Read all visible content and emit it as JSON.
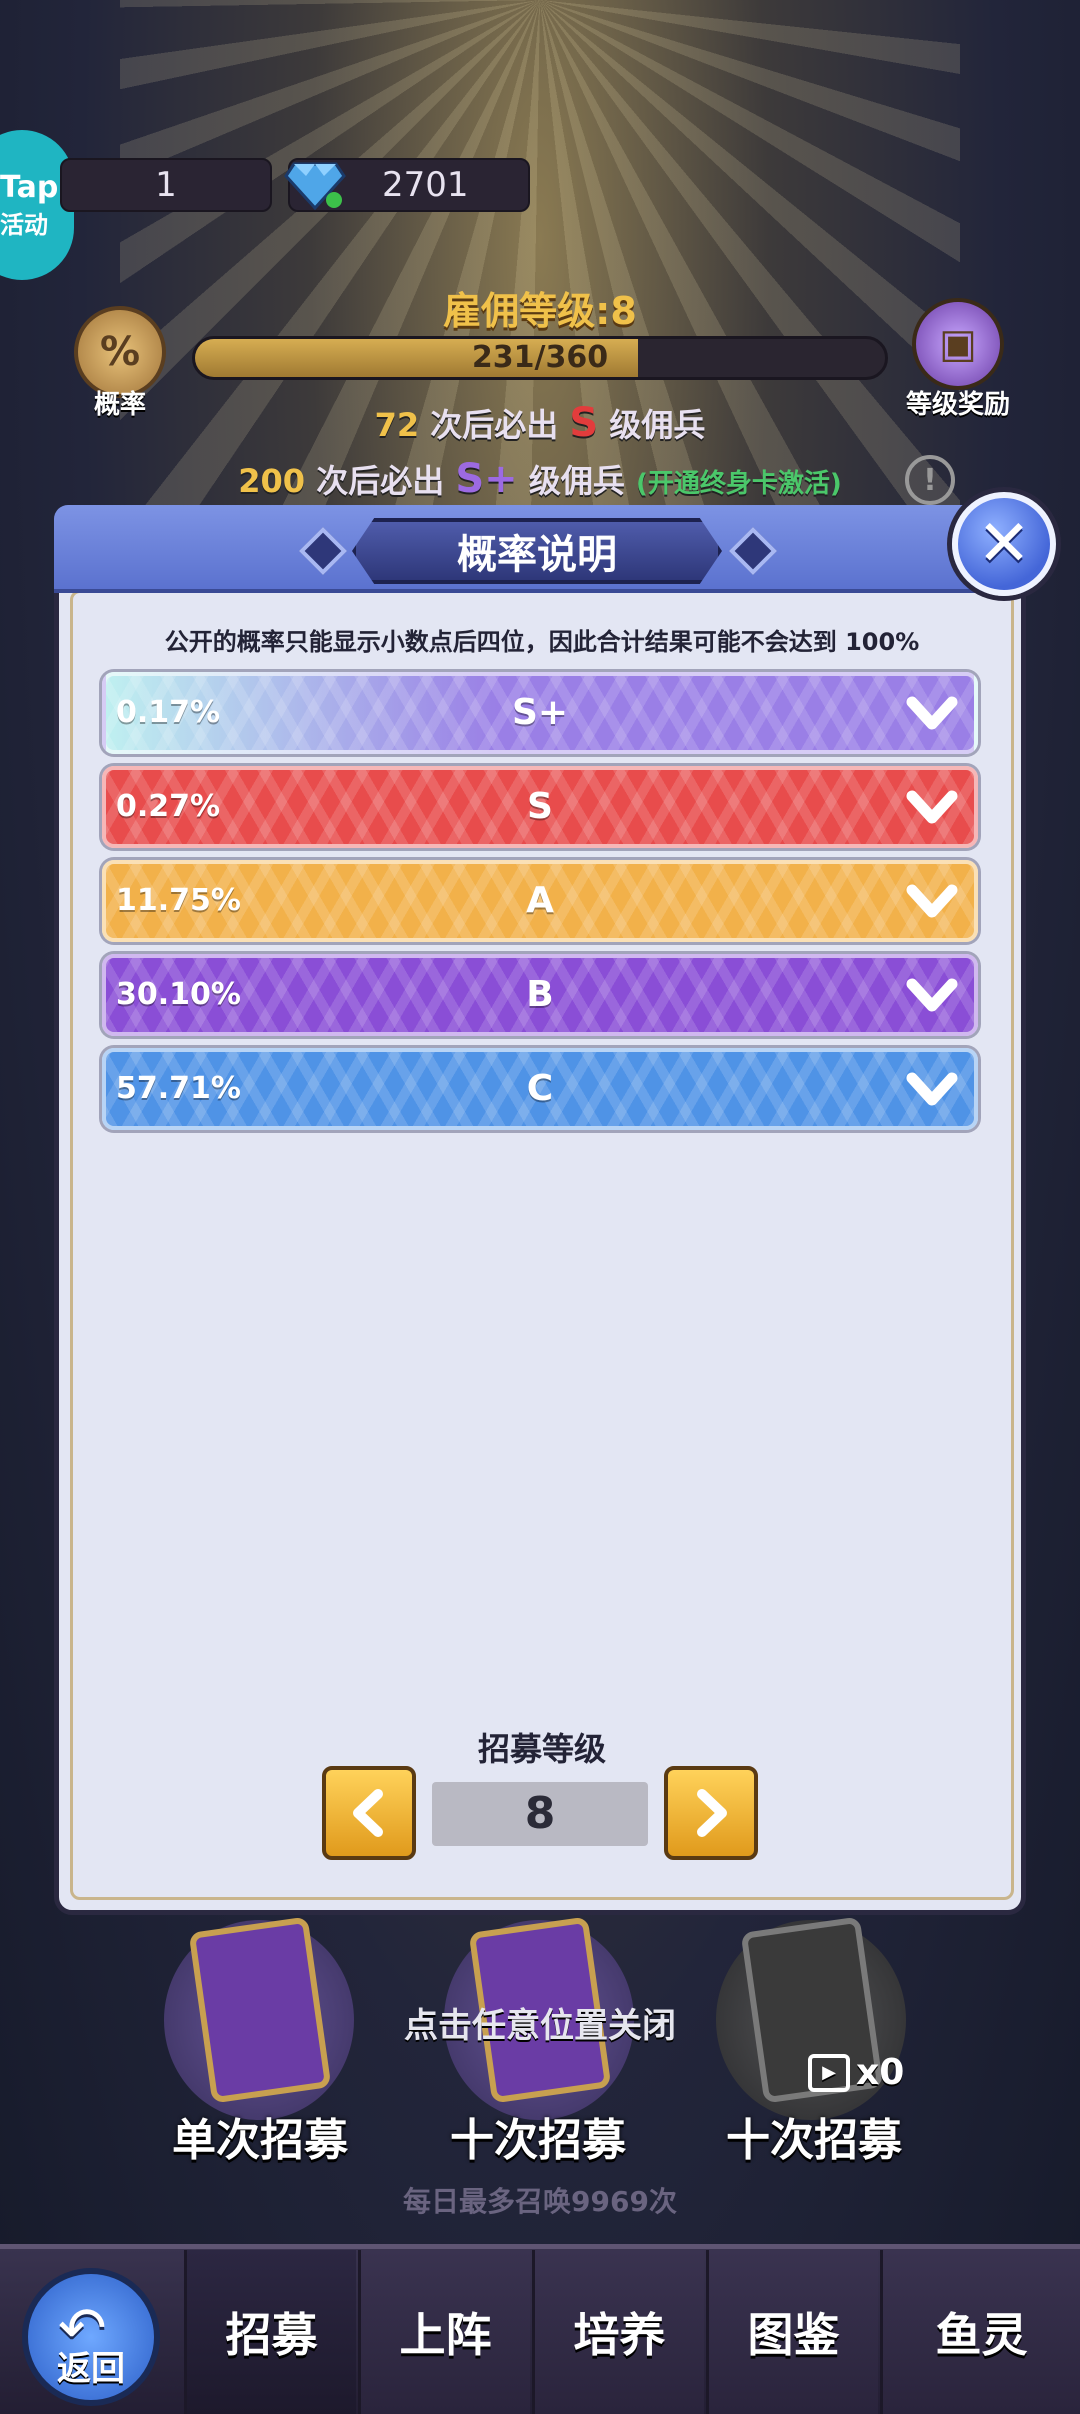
{
  "header": {
    "tap_badge": {
      "line1": "Tap",
      "line2": "活动"
    },
    "resource_1": "1",
    "diamonds": "2701",
    "level_title": "雇佣等级:8",
    "progress": {
      "text": "231/360",
      "fraction": 0.6417
    },
    "left_icon_label": "概率",
    "right_icon_label": "等级奖励",
    "pity_1": {
      "num": "72",
      "pre": "次后必出",
      "grade": "S",
      "post": "级佣兵"
    },
    "pity_2": {
      "num": "200",
      "pre": "次后必出",
      "grade": "S+",
      "post": "级佣兵",
      "note": "(开通终身卡激活)"
    }
  },
  "modal": {
    "title": "概率说明",
    "note": "公开的概率只能显示小数点后四位，因此合计结果可能不会达到 100%",
    "rows": [
      {
        "pct": "0.17%",
        "grade": "S+",
        "color": "#9a7fe6",
        "color_left": "#bff0f0"
      },
      {
        "pct": "0.27%",
        "grade": "S",
        "color": "#e84c4c",
        "color_left": "#e84c4c"
      },
      {
        "pct": "11.75%",
        "grade": "A",
        "color": "#f2b14a",
        "color_left": "#f2b14a"
      },
      {
        "pct": "30.10%",
        "grade": "B",
        "color": "#8a4ed6",
        "color_left": "#8a4ed6"
      },
      {
        "pct": "57.71%",
        "grade": "C",
        "color": "#4f93e6",
        "color_left": "#4f93e6"
      }
    ],
    "level_label": "招募等级",
    "level_value": "8"
  },
  "bottom": {
    "tap_to_close": "点击任意位置关闭",
    "draw_single": "单次招募",
    "draw_ten": "十次招募",
    "draw_ten_ad": "十次招募",
    "ad_count": "x0",
    "daily_limit": "每日最多召唤9969次"
  },
  "nav": {
    "back": "返回",
    "items": [
      "招募",
      "上阵",
      "培养",
      "图鉴",
      "鱼灵"
    ]
  }
}
